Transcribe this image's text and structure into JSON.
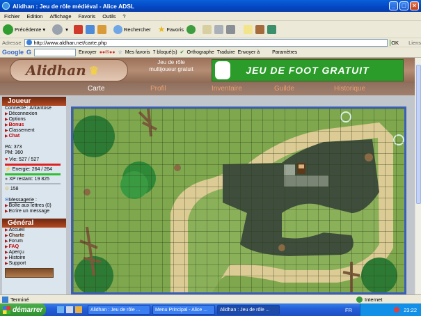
{
  "window": {
    "title": "Alidhan : Jeu de rôle médiéval - Alice ADSL"
  },
  "menu": [
    "Fichier",
    "Edition",
    "Affichage",
    "Favoris",
    "Outils",
    "?"
  ],
  "toolbar": {
    "back": "Précédente",
    "search": "Rechercher",
    "favorites": "Favoris"
  },
  "address": {
    "label": "Adresse",
    "url": "http://www.aldhan.net/carte.php",
    "go": "OK",
    "links": "Liens"
  },
  "google": {
    "brand": "Google",
    "send": "Envoyer",
    "favs": "Mes favoris",
    "blocked": "7 bloqué(s)",
    "spell": "Orthographe",
    "translate": "Traduire",
    "sendto": "Envoyer à",
    "params": "Paramètres"
  },
  "site": {
    "logo": "Alidhan",
    "tagline": "Jeu de rôle multijoueur gratuit",
    "ad": "JEU DE FOOT GRATUIT",
    "nav": [
      "Carte",
      "Profil",
      "Inventaire",
      "Guilde",
      "Historique"
    ]
  },
  "sidebar": {
    "joueur": "Joueur",
    "connected": "Connecté : Arkantose",
    "links": [
      "Déconnexion",
      "Options",
      "Bonus",
      "Classement",
      "Chat"
    ],
    "pa": "PA: 373",
    "pm": "PM: 360",
    "vie": "Vie: 527 / 527",
    "energie": "Energie: 264 / 264",
    "xp": "XP restant: 19 825",
    "gold": "158",
    "messagerie": "Messagerie",
    "msg_links": [
      "Boîte aux lettres (0)",
      "Ecrire un message"
    ],
    "general": "Général",
    "general_links": [
      "Accueil",
      "Charte",
      "Forum",
      "FAQ",
      "Aperçu",
      "Histoire",
      "Support"
    ]
  },
  "status": {
    "left": "Terminé",
    "zone": "Internet"
  },
  "taskbar": {
    "start": "démarrer",
    "tasks": [
      "Alidhan : Jeu de rôle ...",
      "Menu Principal - Alice ...",
      "Alidhan : Jeu de rôle ..."
    ],
    "lang": "FR",
    "clock": "23:22"
  }
}
